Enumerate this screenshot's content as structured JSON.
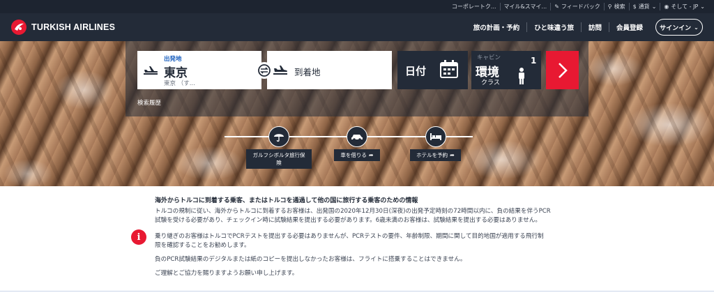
{
  "utility_bar": {
    "items": [
      {
        "label": "コーポレートク...",
        "icon": "none"
      },
      {
        "label": "マイル&スマイ...",
        "icon": "none"
      },
      {
        "label": "フィードバック",
        "icon": "speech-bubble-icon"
      },
      {
        "label": "検索",
        "icon": "search-icon"
      },
      {
        "label": "通貨",
        "icon": "dollar-icon"
      },
      {
        "label": "そして - JP",
        "icon": "globe-icon"
      }
    ]
  },
  "nav": {
    "brand": "TURKISH AIRLINES",
    "menu": [
      "旅の計画・予約",
      "ひと味違う旅",
      "訪問",
      "会員登録"
    ],
    "signin": "サインイン"
  },
  "search": {
    "from_label": "出発地",
    "from_value": "東京",
    "from_sub": "東京 （す...",
    "to_placeholder": "到着地",
    "date_label": "日付",
    "cabin_label": "キャビン",
    "cabin_value": "環境",
    "cabin_sub": "クラス",
    "passenger_count": "1",
    "history": "検索履歴"
  },
  "services": [
    {
      "label_line1": "ガルフシボルタ旅行保",
      "label_line2": "険",
      "icon": "umbrella-icon"
    },
    {
      "label_line1": "車を借りる",
      "label_line2": "",
      "icon": "car-icon"
    },
    {
      "label_line1": "ホテルを予約",
      "label_line2": "",
      "icon": "bed-icon"
    }
  ],
  "notice": {
    "title": "海外からトルコに到着する乗客、またはトルコを通過して他の国に旅行する乗客のための情報",
    "p1_line1": "トルコの規制に従い、海外からトルコに到着するお客様は、出発国の2020年12月30日(深夜)の出発予定時刻の72時間以内に、負の結果を伴うPCR",
    "p1_line2": "試験を受ける必要があり、チェックイン時に試験結果を提出する必要があります。6歳未満のお客様は、試験結果を提出する必要はありません。",
    "p2_line1": "乗り継ぎのお客様はトルコでPCRテストを提出する必要はありませんが、PCRテストの要件、年齢制限、期間に関して目的地国が適用する飛行制",
    "p2_line2": "限を確認することをお勧めします。",
    "p3": "負のPCR試験結果のデジタルまたは紙のコピーを提出しなかったお客様は、フライトに搭乗することはできません。",
    "p4": "ご理解とご協力を賜りますようお願い申し上げます。"
  },
  "colors": {
    "brand_red": "#e81932",
    "navy": "#232b38",
    "link_blue": "#1a5fbf"
  }
}
